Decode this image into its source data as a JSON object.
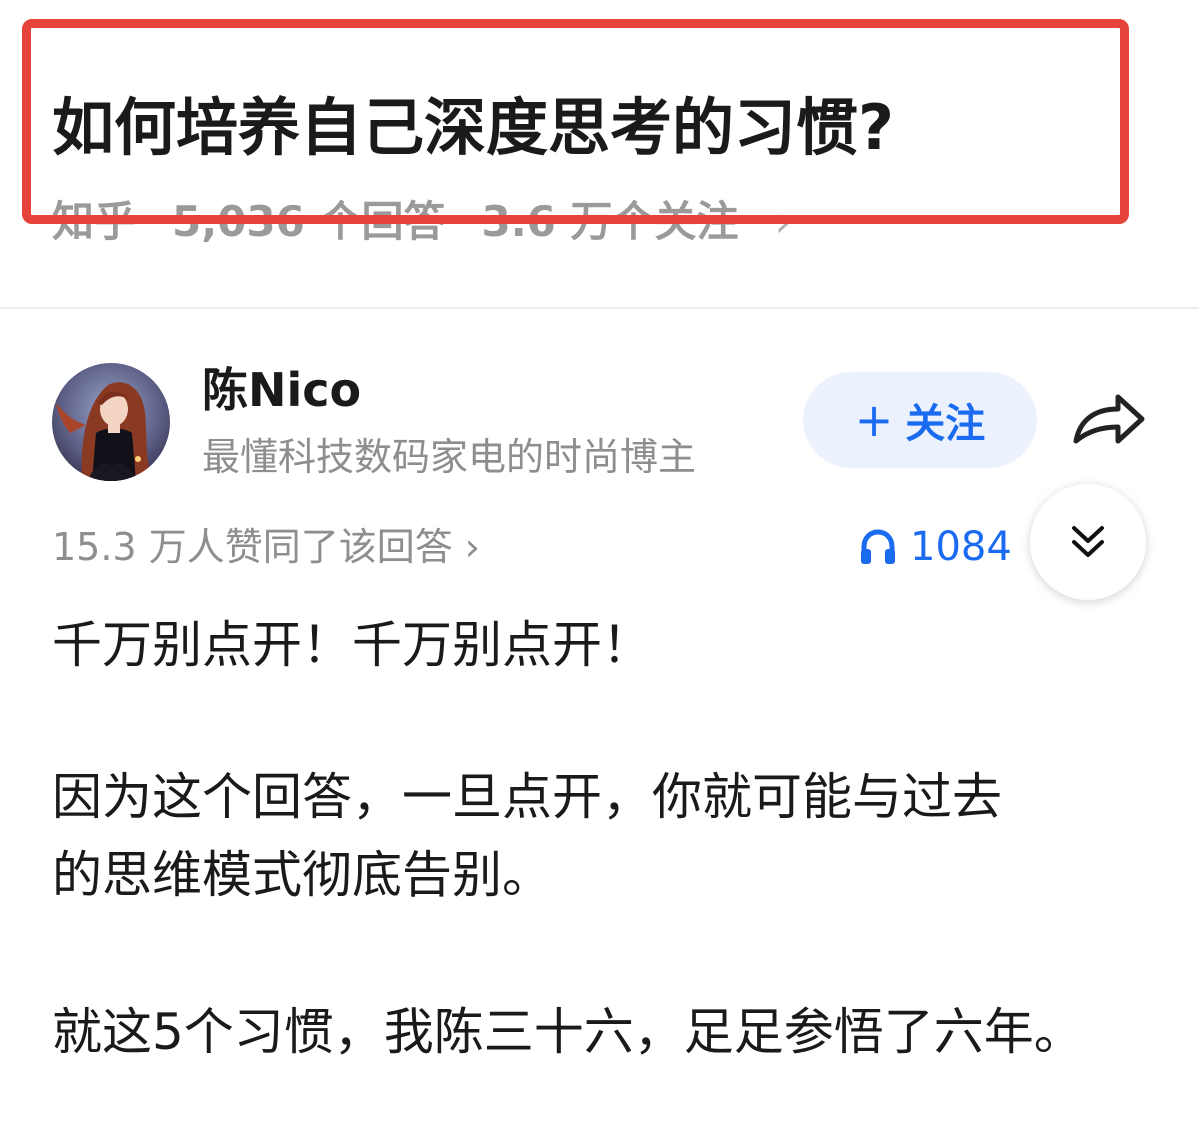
{
  "question": {
    "title": "如何培养自己深度思考的习惯?",
    "source": "知乎",
    "answers_count": "5,036 个回答",
    "followers_count": "3.6 万个关注",
    "chevron": "›"
  },
  "author": {
    "name": "陈Nico",
    "bio": "最懂科技数码家电的时尚博主",
    "follow_label": "关注",
    "follow_plus": "+"
  },
  "answer": {
    "approve_text": "15.3 万人赞同了该回答",
    "approve_chevron": "›",
    "listen_count": "1084",
    "paragraphs": [
      "千万别点开！千万别点开！",
      "因为这个回答，一旦点开，你就可能与过去",
      "的思维模式彻底告别。",
      "就这5个习惯，我陈三十六，足足参悟了六年。"
    ]
  },
  "icons": {
    "share": "share-arrow-icon",
    "headphones": "headphones-icon",
    "collapse": "double-chevron-down-icon"
  },
  "colors": {
    "accent": "#1a6bf0",
    "highlight": "#e6443a",
    "follow_bg": "#ebf2fe",
    "muted_text": "#8e8e8e"
  }
}
